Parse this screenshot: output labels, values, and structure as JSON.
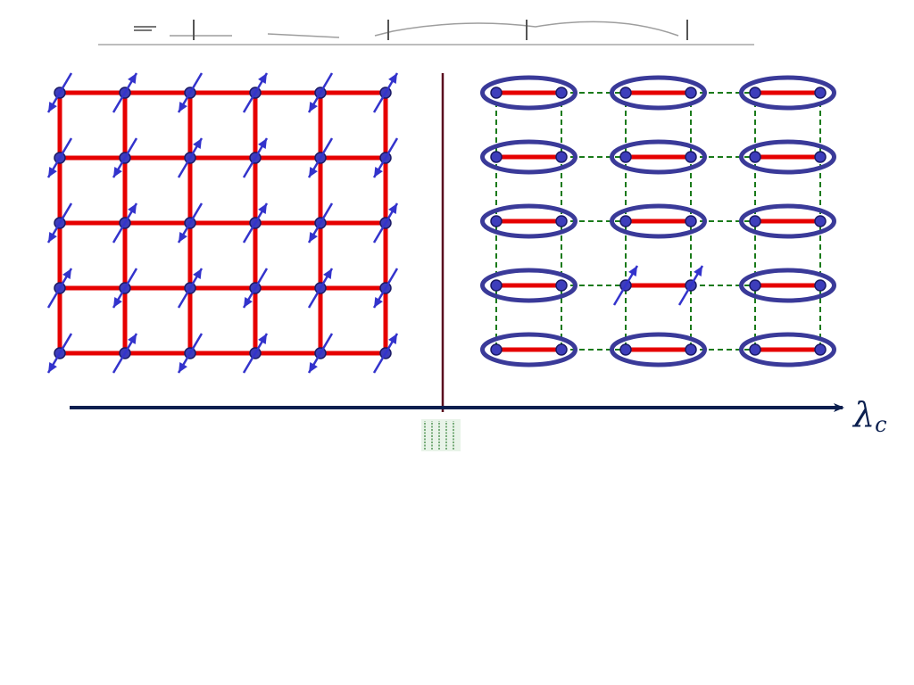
{
  "axis": {
    "symbol": "λ",
    "subscript": "c"
  },
  "colors": {
    "bond_strong": "#e60000",
    "bond_weak_dashed": "#1a7a1a",
    "site_fill": "#3d3dbb",
    "site_stroke": "#1a1a66",
    "spin_arrow": "#3333cc",
    "dimer_ellipse": "#3a3a99",
    "divider": "#5a0a1e",
    "axis_arrow": "#0b1f4f",
    "axis_label": "#0b1f4f",
    "blurred_header": "#555555",
    "blurred_critical_label": "#2e7d32"
  },
  "left_panel": {
    "phase": "antiferromagnetic-order",
    "columns": 6,
    "rows": 5,
    "spin_orientations": [
      [
        "down",
        "up",
        "down",
        "up",
        "down",
        "up"
      ],
      [
        "down",
        "down",
        "up",
        "up",
        "down",
        "down"
      ],
      [
        "down",
        "up",
        "down",
        "up",
        "down",
        "up"
      ],
      [
        "up",
        "down",
        "up",
        "down",
        "up",
        "down"
      ],
      [
        "down",
        "up",
        "down",
        "up",
        "down",
        "up"
      ]
    ]
  },
  "right_panel": {
    "phase": "dimer-singlet",
    "dimer_columns": 3,
    "rows": 5,
    "broken_dimer": {
      "row": 4,
      "column": 2,
      "spins": [
        "up",
        "up"
      ]
    }
  },
  "icons": {
    "spin": "spin-arrow-icon",
    "axis": "arrow-right-icon"
  }
}
